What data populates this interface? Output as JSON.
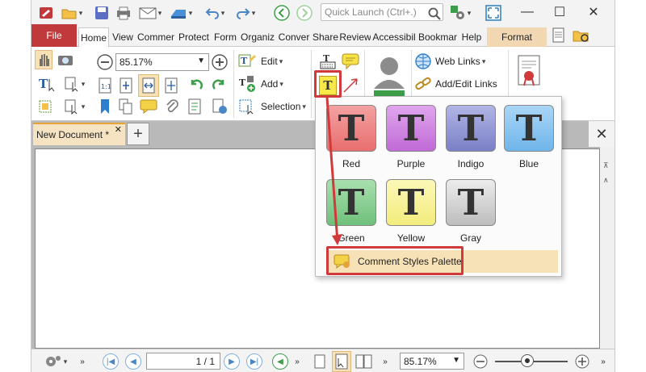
{
  "app": {
    "search_placeholder": "Quick Launch (Ctrl+.)"
  },
  "tabs": [
    {
      "label": "File"
    },
    {
      "label": "Home"
    },
    {
      "label": "View"
    },
    {
      "label": "Commer"
    },
    {
      "label": "Protect"
    },
    {
      "label": "Form"
    },
    {
      "label": "Organiz"
    },
    {
      "label": "Conver"
    },
    {
      "label": "Share"
    },
    {
      "label": "Review"
    },
    {
      "label": "Accessibil"
    },
    {
      "label": "Bookmar"
    },
    {
      "label": "Help"
    },
    {
      "label": "Format"
    }
  ],
  "ribbon": {
    "zoom_value": "85.17%",
    "edit_label": "Edit",
    "add_label": "Add",
    "selection_label": "Selection",
    "web_links_label": "Web Links",
    "add_edit_links_label": "Add/Edit Links"
  },
  "document": {
    "tab_label": "New Document *",
    "close_tab_glyph": "✕"
  },
  "statusbar": {
    "page_value": "1 / 1",
    "zoom_value": "85.17%"
  },
  "palette": {
    "styles": [
      {
        "label": "Red",
        "color": "#e86e6e"
      },
      {
        "label": "Purple",
        "color": "#c06ad6"
      },
      {
        "label": "Indigo",
        "color": "#7a7fc7"
      },
      {
        "label": "Blue",
        "color": "#6fb5ea"
      },
      {
        "label": "Green",
        "color": "#6fc07a"
      },
      {
        "label": "Yellow",
        "color": "#f3ec7c"
      },
      {
        "label": "Gray",
        "color": "#c9c9c9"
      }
    ],
    "glyph": "T",
    "menu_item_label": "Comment Styles Palette"
  },
  "colors": {
    "accent_red": "#d03a3a",
    "file_tab": "#c0393b",
    "format_tab": "#f1d8b3"
  }
}
